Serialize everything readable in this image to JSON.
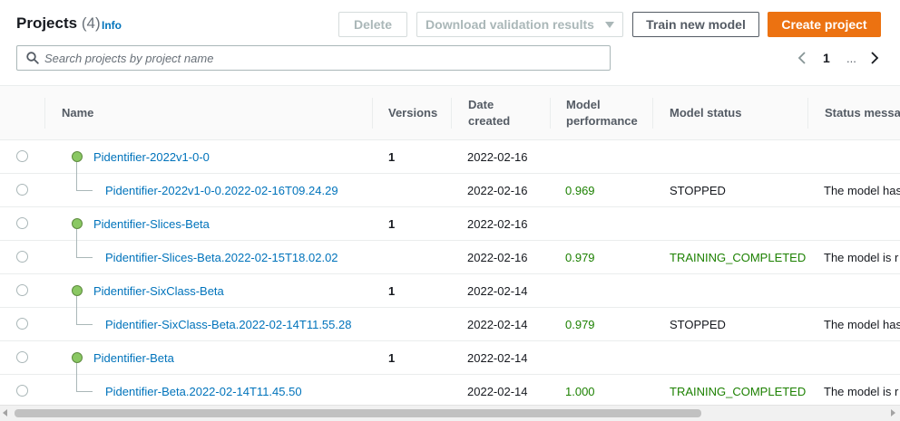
{
  "header": {
    "title": "Projects",
    "count": "(4)",
    "info": "Info"
  },
  "toolbar": {
    "delete_label": "Delete",
    "download_label": "Download validation results",
    "train_label": "Train new model",
    "create_label": "Create project"
  },
  "search": {
    "placeholder": "Search projects by project name",
    "value": ""
  },
  "pagination": {
    "current_page": "1",
    "ellipsis": "..."
  },
  "table": {
    "columns": {
      "name": "Name",
      "versions": "Versions",
      "date_created": "Date created",
      "model_performance": "Model performance",
      "model_status": "Model status",
      "status_message": "Status message"
    },
    "rows": [
      {
        "kind": "project",
        "name": "Pidentifier-2022v1-0-0",
        "versions": "1",
        "date": "2022-02-16",
        "performance": "",
        "status": "",
        "message": ""
      },
      {
        "kind": "model",
        "name": "Pidentifier-2022v1-0-0.2022-02-16T09.24.29",
        "versions": "",
        "date": "2022-02-16",
        "performance": "0.969",
        "status": "STOPPED",
        "message": "The model has"
      },
      {
        "kind": "project",
        "name": "Pidentifier-Slices-Beta",
        "versions": "1",
        "date": "2022-02-16",
        "performance": "",
        "status": "",
        "message": ""
      },
      {
        "kind": "model",
        "name": "Pidentifier-Slices-Beta.2022-02-15T18.02.02",
        "versions": "",
        "date": "2022-02-16",
        "performance": "0.979",
        "status": "TRAINING_COMPLETED",
        "message": "The model is r"
      },
      {
        "kind": "project",
        "name": "Pidentifier-SixClass-Beta",
        "versions": "1",
        "date": "2022-02-14",
        "performance": "",
        "status": "",
        "message": ""
      },
      {
        "kind": "model",
        "name": "Pidentifier-SixClass-Beta.2022-02-14T11.55.28",
        "versions": "",
        "date": "2022-02-14",
        "performance": "0.979",
        "status": "STOPPED",
        "message": "The model has"
      },
      {
        "kind": "project",
        "name": "Pidentifier-Beta",
        "versions": "1",
        "date": "2022-02-14",
        "performance": "",
        "status": "",
        "message": ""
      },
      {
        "kind": "model",
        "name": "Pidentifier-Beta.2022-02-14T11.45.50",
        "versions": "",
        "date": "2022-02-14",
        "performance": "1.000",
        "status": "TRAINING_COMPLETED",
        "message": "The model is r"
      }
    ]
  },
  "colors": {
    "accent": "#ec7211",
    "link": "#0073bb",
    "success": "#1d8102",
    "node": "#8ac863"
  },
  "icons": {
    "search": "search-icon",
    "prev": "chevron-left-icon",
    "next": "chevron-right-icon",
    "dropdown": "caret-down-icon"
  }
}
